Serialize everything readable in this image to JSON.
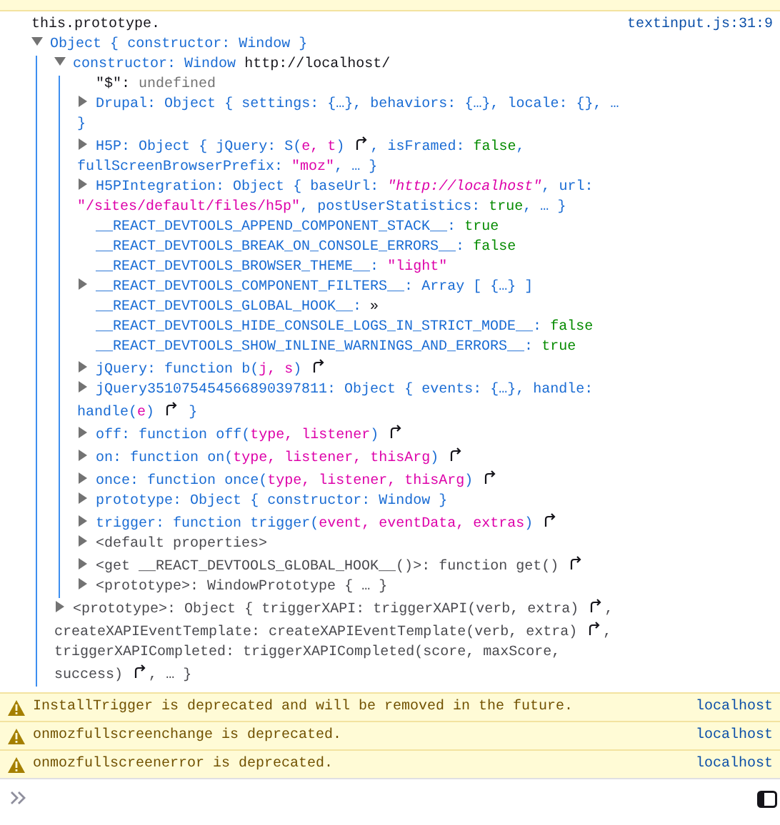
{
  "message": {
    "text": "this.prototype.",
    "location": "textinput.js:31:9"
  },
  "tree": [
    {
      "kind": "group",
      "expanded": true,
      "tokens": [
        {
          "kind": "name",
          "text": "Object { constructor: Window }"
        }
      ],
      "children": [
        {
          "kind": "group",
          "expanded": true,
          "tokens": [
            {
              "kind": "name",
              "text": "constructor: Window "
            },
            {
              "kind": "plain",
              "text": "http://localhost/"
            }
          ],
          "children": [
            {
              "kind": "leaf",
              "tokens": [
                {
                  "kind": "plain",
                  "text": "\"$\": "
                },
                {
                  "kind": "undef",
                  "text": "undefined"
                }
              ]
            },
            {
              "kind": "group",
              "expanded": false,
              "tokens": [
                {
                  "kind": "name",
                  "text": "Drupal: Object { settings: {…}, behaviors: {…}, locale: {}, … }"
                }
              ]
            },
            {
              "kind": "group",
              "expanded": false,
              "tokens": [
                {
                  "kind": "name",
                  "text": "H5P: Object { jQuery: S("
                },
                {
                  "kind": "param",
                  "text": "e, t"
                },
                {
                  "kind": "name",
                  "text": ") "
                },
                {
                  "kind": "jump"
                },
                {
                  "kind": "name",
                  "text": ", isFramed: "
                },
                {
                  "kind": "bool",
                  "text": "false"
                },
                {
                  "kind": "name",
                  "text": ", fullScreenBrowserPrefix: "
                },
                {
                  "kind": "str",
                  "text": "\"moz\""
                },
                {
                  "kind": "name",
                  "text": ", … }"
                }
              ]
            },
            {
              "kind": "group",
              "expanded": false,
              "tokens": [
                {
                  "kind": "name",
                  "text": "H5PIntegration: Object { baseUrl: "
                },
                {
                  "kind": "url",
                  "text": "\"http://localhost\""
                },
                {
                  "kind": "name",
                  "text": ", url: "
                },
                {
                  "kind": "str",
                  "text": "\"/sites/default/files/h5p\""
                },
                {
                  "kind": "name",
                  "text": ", postUserStatistics: "
                },
                {
                  "kind": "bool",
                  "text": "true"
                },
                {
                  "kind": "name",
                  "text": ", … }"
                }
              ]
            },
            {
              "kind": "leaf",
              "tokens": [
                {
                  "kind": "name",
                  "text": "__REACT_DEVTOOLS_APPEND_COMPONENT_STACK__: "
                },
                {
                  "kind": "bool",
                  "text": "true"
                }
              ]
            },
            {
              "kind": "leaf",
              "tokens": [
                {
                  "kind": "name",
                  "text": "__REACT_DEVTOOLS_BREAK_ON_CONSOLE_ERRORS__: "
                },
                {
                  "kind": "bool",
                  "text": "false"
                }
              ]
            },
            {
              "kind": "leaf",
              "tokens": [
                {
                  "kind": "name",
                  "text": "__REACT_DEVTOOLS_BROWSER_THEME__: "
                },
                {
                  "kind": "str",
                  "text": "\"light\""
                }
              ]
            },
            {
              "kind": "group",
              "expanded": false,
              "tokens": [
                {
                  "kind": "name",
                  "text": "__REACT_DEVTOOLS_COMPONENT_FILTERS__: Array [ {…} ]"
                }
              ]
            },
            {
              "kind": "leaf",
              "tokens": [
                {
                  "kind": "name",
                  "text": "__REACT_DEVTOOLS_GLOBAL_HOOK__: "
                },
                {
                  "kind": "plain",
                  "text": "»"
                }
              ]
            },
            {
              "kind": "leaf",
              "tokens": [
                {
                  "kind": "name",
                  "text": "__REACT_DEVTOOLS_HIDE_CONSOLE_LOGS_IN_STRICT_MODE__: "
                },
                {
                  "kind": "bool",
                  "text": "false"
                }
              ]
            },
            {
              "kind": "leaf",
              "tokens": [
                {
                  "kind": "name",
                  "text": "__REACT_DEVTOOLS_SHOW_INLINE_WARNINGS_AND_ERRORS__: "
                },
                {
                  "kind": "bool",
                  "text": "true"
                }
              ]
            },
            {
              "kind": "group",
              "expanded": false,
              "tokens": [
                {
                  "kind": "name",
                  "text": "jQuery: function b("
                },
                {
                  "kind": "param",
                  "text": "j, s"
                },
                {
                  "kind": "name",
                  "text": ") "
                },
                {
                  "kind": "jump"
                }
              ]
            },
            {
              "kind": "group",
              "expanded": false,
              "tokens": [
                {
                  "kind": "name",
                  "text": "jQuery351075454566890397811: Object { events: {…}, handle: handle("
                },
                {
                  "kind": "param",
                  "text": "e"
                },
                {
                  "kind": "name",
                  "text": ") "
                },
                {
                  "kind": "jump"
                },
                {
                  "kind": "name",
                  "text": " }"
                }
              ]
            },
            {
              "kind": "group",
              "expanded": false,
              "tokens": [
                {
                  "kind": "name",
                  "text": "off: function off("
                },
                {
                  "kind": "param",
                  "text": "type, listener"
                },
                {
                  "kind": "name",
                  "text": ") "
                },
                {
                  "kind": "jump"
                }
              ]
            },
            {
              "kind": "group",
              "expanded": false,
              "tokens": [
                {
                  "kind": "name",
                  "text": "on: function on("
                },
                {
                  "kind": "param",
                  "text": "type, listener, thisArg"
                },
                {
                  "kind": "name",
                  "text": ") "
                },
                {
                  "kind": "jump"
                }
              ]
            },
            {
              "kind": "group",
              "expanded": false,
              "tokens": [
                {
                  "kind": "name",
                  "text": "once: function once("
                },
                {
                  "kind": "param",
                  "text": "type, listener, thisArg"
                },
                {
                  "kind": "name",
                  "text": ") "
                },
                {
                  "kind": "jump"
                }
              ]
            },
            {
              "kind": "group",
              "expanded": false,
              "tokens": [
                {
                  "kind": "name",
                  "text": "prototype: Object { constructor: Window }"
                }
              ]
            },
            {
              "kind": "group",
              "expanded": false,
              "tokens": [
                {
                  "kind": "name",
                  "text": "trigger: function trigger("
                },
                {
                  "kind": "param",
                  "text": "event, eventData, extras"
                },
                {
                  "kind": "name",
                  "text": ") "
                },
                {
                  "kind": "jump"
                }
              ]
            },
            {
              "kind": "group",
              "expanded": false,
              "tokens": [
                {
                  "kind": "muted",
                  "text": "<default properties>"
                }
              ]
            },
            {
              "kind": "group",
              "expanded": false,
              "tokens": [
                {
                  "kind": "muted",
                  "text": "<get __REACT_DEVTOOLS_GLOBAL_HOOK__()>: function get() "
                },
                {
                  "kind": "jump"
                }
              ]
            },
            {
              "kind": "group",
              "expanded": false,
              "tokens": [
                {
                  "kind": "muted",
                  "text": "<prototype>: WindowPrototype { … }"
                }
              ]
            }
          ]
        },
        {
          "kind": "group",
          "expanded": false,
          "tokens": [
            {
              "kind": "muted",
              "text": "<prototype>: Object { triggerXAPI: triggerXAPI(verb, extra) "
            },
            {
              "kind": "jump"
            },
            {
              "kind": "muted",
              "text": ", createXAPIEventTemplate: createXAPIEventTemplate(verb, extra) "
            },
            {
              "kind": "jump"
            },
            {
              "kind": "muted",
              "text": ", triggerXAPICompleted: triggerXAPICompleted(score, maxScore, success) "
            },
            {
              "kind": "jump"
            },
            {
              "kind": "muted",
              "text": ", … }"
            }
          ]
        }
      ]
    }
  ],
  "warnings": [
    {
      "text": "InstallTrigger is deprecated and will be removed in the future.",
      "location": "localhost"
    },
    {
      "text": "onmozfullscreenchange is deprecated.",
      "location": "localhost"
    },
    {
      "text": "onmozfullscreenerror is deprecated.",
      "location": "localhost"
    }
  ]
}
